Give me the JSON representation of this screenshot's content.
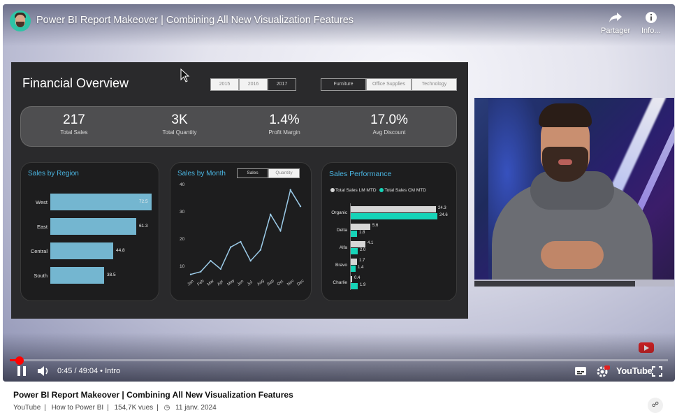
{
  "player": {
    "title": "Power BI Report Makeover | Combining All New Visualization Features",
    "share_label": "Partager",
    "info_label": "Info...",
    "time": "0:45 / 49:04",
    "chapter": "• Intro",
    "progress_fraction": 0.015,
    "brand": "YouTube"
  },
  "dashboard": {
    "title": "Financial Overview",
    "years": [
      "2015",
      "2016",
      "2017"
    ],
    "selected_year": "2017",
    "categories": [
      "Furniture",
      "Office Supplies",
      "Technology"
    ],
    "kpis": [
      {
        "value": "217",
        "label": "Total Sales"
      },
      {
        "value": "3K",
        "label": "Total Quantity"
      },
      {
        "value": "1.4%",
        "label": "Profit Margin"
      },
      {
        "value": "17.0%",
        "label": "Avg Discount"
      }
    ],
    "region": {
      "title": "Sales by Region",
      "rows": [
        {
          "label": "West",
          "value": 72.5
        },
        {
          "label": "East",
          "value": 61.3
        },
        {
          "label": "Central",
          "value": 44.8
        },
        {
          "label": "South",
          "value": 38.5
        }
      ]
    },
    "month": {
      "title": "Sales by Month",
      "toggle": [
        "Sales",
        "Quantity"
      ],
      "yticks": [
        "40",
        "30",
        "20",
        "10"
      ],
      "months": [
        "Jan",
        "Feb",
        "Mar",
        "Apr",
        "May",
        "Jun",
        "Jul",
        "Aug",
        "Sep",
        "Oct",
        "Nov",
        "Dec"
      ],
      "values": [
        7,
        8,
        12,
        9,
        17,
        19,
        12,
        16,
        29,
        23,
        38,
        32
      ]
    },
    "perf": {
      "title": "Sales Performance",
      "legend_lm": "Total Sales LM MTD",
      "legend_cm": "Total Sales CM MTD",
      "rows": [
        {
          "label": "Organic",
          "lm": "24.3",
          "cm": "24.6",
          "lm_v": 24.3,
          "cm_v": 24.6
        },
        {
          "label": "Delta",
          "lm": "5.6",
          "cm": "1.8",
          "lm_v": 5.6,
          "cm_v": 1.8
        },
        {
          "label": "Alfa",
          "lm": "4.1",
          "cm": "2.0",
          "lm_v": 4.1,
          "cm_v": 2.0
        },
        {
          "label": "Bravo",
          "lm": "1.7",
          "cm": "1.4",
          "lm_v": 1.7,
          "cm_v": 1.4
        },
        {
          "label": "Charlie",
          "lm": "0.4",
          "cm": "1.9",
          "lm_v": 0.4,
          "cm_v": 1.9
        }
      ]
    }
  },
  "below": {
    "title": "Power BI Report Makeover | Combining All New Visualization Features",
    "source": "YouTube",
    "channel": "How to Power BI",
    "views": "154,7K vues",
    "date": "11 janv. 2024"
  },
  "colors": {
    "accent": "#ff0000",
    "teal": "#16d4b8",
    "region_bar": "#74b6d0",
    "title_blue": "#4ab4e0"
  }
}
